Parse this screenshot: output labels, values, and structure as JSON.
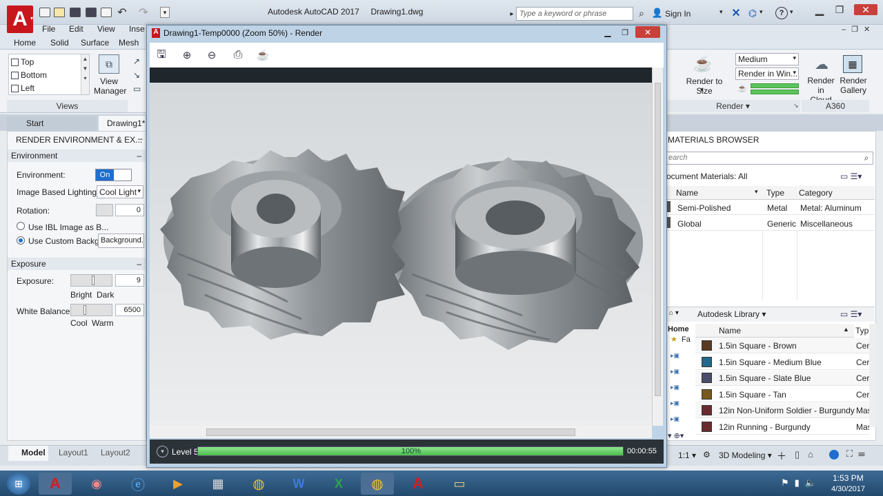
{
  "app": {
    "title": "Autodesk AutoCAD 2017",
    "document": "Drawing1.dwg",
    "logo_letter": "A"
  },
  "search": {
    "placeholder": "Type a keyword or phrase"
  },
  "account": {
    "sign_in": "Sign In"
  },
  "menu": [
    "File",
    "Edit",
    "View",
    "Inse"
  ],
  "ribbon_tabs": [
    "Home",
    "Solid",
    "Surface",
    "Mesh"
  ],
  "views_panel": {
    "items": [
      "Top",
      "Bottom",
      "Left"
    ],
    "view_manager": [
      "View",
      "Manager"
    ],
    "label": "Views"
  },
  "render_panel": {
    "render_to_size": [
      "Render to Size"
    ],
    "quality": "Medium",
    "render_in": "Render in Win...",
    "render_in_cloud": [
      "Render in",
      "Cloud"
    ],
    "render_gallery": [
      "Render",
      "Gallery"
    ],
    "label": "Render",
    "a360": "A360"
  },
  "file_tabs": [
    "Start",
    "Drawing1*"
  ],
  "render_env": {
    "title": "RENDER ENVIRONMENT & EX...",
    "environment_section": "Environment",
    "environment_label": "Environment:",
    "environment_toggle": "On",
    "ibl_label": "Image Based Lighting:",
    "ibl_value": "Cool Light",
    "rotation_label": "Rotation:",
    "rotation_value": "0",
    "use_ibl": "Use IBL Image as B...",
    "use_custom": "Use Custom Backg...",
    "background_btn": "Background...",
    "exposure_section": "Exposure",
    "exposure_label": "Exposure:",
    "exposure_value": "9",
    "bright": "Bright",
    "dark": "Dark",
    "white_balance_label": "White Balance:",
    "white_balance_value": "6500",
    "cool": "Cool",
    "warm": "Warm"
  },
  "render_window": {
    "title": "Drawing1-Temp0000 (Zoom 50%) - Render",
    "level": "Level 5",
    "progress_text": "100%",
    "progress_fraction": 1.0,
    "elapsed": "00:00:55"
  },
  "materials": {
    "title": "MATERIALS BROWSER",
    "search_placeholder": "earch",
    "doc_filter": "ocument Materials: All",
    "columns": [
      "Name",
      "Type",
      "Category"
    ],
    "rows": [
      {
        "name": "Semi-Polished",
        "type": "Metal",
        "category": "Metal: Aluminum"
      },
      {
        "name": "Global",
        "type": "Generic",
        "category": "Miscellaneous"
      }
    ],
    "library": "Autodesk Library",
    "lib_columns": [
      "Name",
      "Typ"
    ],
    "lib_tree": [
      "Home",
      "Fa"
    ],
    "lib_rows": [
      {
        "name": "1.5in Square - Brown",
        "type": "Cer",
        "color": "#5a3a22"
      },
      {
        "name": "1.5in Square - Medium Blue",
        "type": "Cer",
        "color": "#1f6a8a"
      },
      {
        "name": "1.5in Square - Slate Blue",
        "type": "Cer",
        "color": "#4a4e6a"
      },
      {
        "name": "1.5in Square - Tan",
        "type": "Cer",
        "color": "#7a5a1a"
      },
      {
        "name": "12in Non-Uniform Soldier - Burgundy",
        "type": "Mas",
        "color": "#6a2a30"
      },
      {
        "name": "12in Running - Burgundy",
        "type": "Mas",
        "color": "#6a2a30"
      }
    ]
  },
  "layout_tabs": [
    "Model",
    "Layout1",
    "Layout2"
  ],
  "status_right": {
    "scale": "1:1",
    "workspace": "3D Modeling"
  },
  "clock": {
    "time": "1:53 PM",
    "date": "4/30/2017"
  }
}
